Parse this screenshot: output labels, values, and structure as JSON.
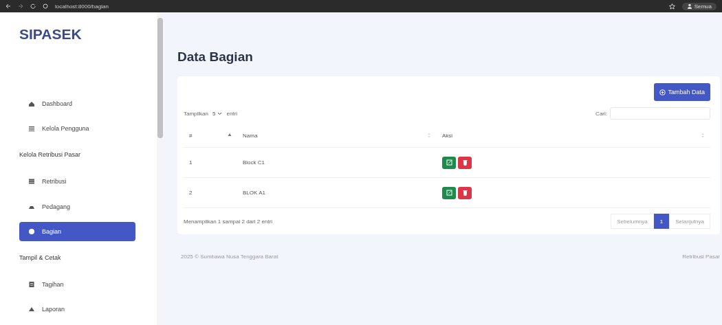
{
  "browser": {
    "url": "localhost:8000/bagian",
    "profile": "Semua"
  },
  "sidebar": {
    "brand": "SIPASEK",
    "items": [
      {
        "kind": "link",
        "label": "Dashboard",
        "selected": false
      },
      {
        "kind": "link",
        "label": "Kelola Pengguna",
        "selected": false
      },
      {
        "kind": "header",
        "label": "Kelola Retribusi Pasar"
      },
      {
        "kind": "link",
        "label": "Retribusi",
        "selected": false
      },
      {
        "kind": "link",
        "label": "Pedagang",
        "selected": false
      },
      {
        "kind": "link",
        "label": "Bagian",
        "selected": true
      },
      {
        "kind": "header",
        "label": "Tampil & Cetak"
      },
      {
        "kind": "link",
        "label": "Tagihan",
        "selected": false
      },
      {
        "kind": "link",
        "label": "Laporan",
        "selected": false
      }
    ]
  },
  "page_title": "Data Bagian",
  "card": {
    "add_button": "Tambah Data",
    "length": {
      "before": "Tampilkan",
      "value": "5",
      "after": "entri"
    },
    "search_label": "Cari:",
    "columns": [
      {
        "label": "#",
        "sorted": true
      },
      {
        "label": "Nama",
        "sorted": false
      },
      {
        "label": "Aksi",
        "sorted": false
      }
    ],
    "rows": [
      {
        "no": "1",
        "name": "Block C1"
      },
      {
        "no": "2",
        "name": "BLOK A1"
      }
    ],
    "info": "Menampilkan 1 sampai 2 dari 2 entri",
    "pagination": [
      {
        "label": "Sebelumnya",
        "selected": false,
        "disabled": true
      },
      {
        "label": "1",
        "selected": true,
        "disabled": false
      },
      {
        "label": "Selanjutnya",
        "selected": false,
        "disabled": true
      }
    ]
  },
  "footer": {
    "left": "2025 © Sumbawa Nusa Tenggara Barat",
    "right": "Retribusi Pasar"
  }
}
